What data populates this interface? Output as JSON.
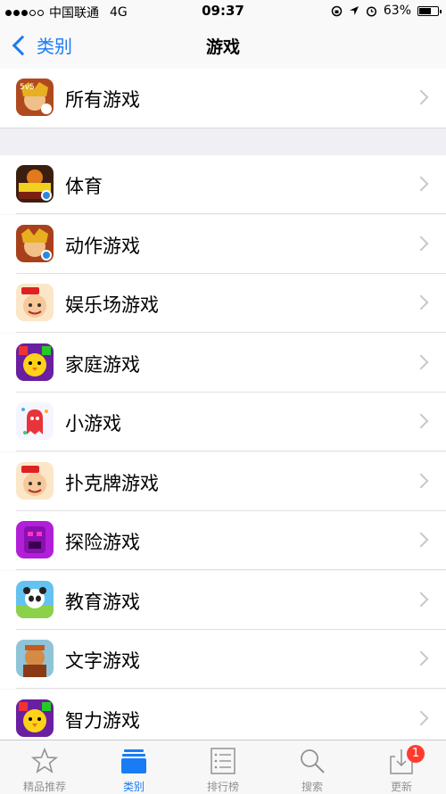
{
  "status_bar": {
    "carrier": "中国联通",
    "network": "4G",
    "time": "09:37",
    "battery": "63%",
    "battery_level": 0.63
  },
  "nav": {
    "back_label": "类别",
    "title": "游戏"
  },
  "all_games": {
    "label": "所有游戏",
    "icon": "king-glory-game-icon"
  },
  "categories": [
    {
      "label": "体育",
      "icon": "basketball-game-icon"
    },
    {
      "label": "动作游戏",
      "icon": "king-glory-game-icon"
    },
    {
      "label": "娱乐场游戏",
      "icon": "cartoon-boy-game-icon"
    },
    {
      "label": "家庭游戏",
      "icon": "chick-game-icon"
    },
    {
      "label": "小游戏",
      "icon": "red-ghost-game-icon"
    },
    {
      "label": "扑克牌游戏",
      "icon": "cartoon-boy-game-icon"
    },
    {
      "label": "探险游戏",
      "icon": "temple-run-game-icon"
    },
    {
      "label": "教育游戏",
      "icon": "panda-game-icon"
    },
    {
      "label": "文字游戏",
      "icon": "warrior-game-icon"
    },
    {
      "label": "智力游戏",
      "icon": "chick-game-icon"
    }
  ],
  "tabs": [
    {
      "label": "精品推荐",
      "icon": "star-icon"
    },
    {
      "label": "类别",
      "icon": "categories-icon",
      "active": true
    },
    {
      "label": "排行榜",
      "icon": "list-icon"
    },
    {
      "label": "搜索",
      "icon": "search-icon"
    },
    {
      "label": "更新",
      "icon": "download-icon",
      "badge": "1"
    }
  ],
  "colors": {
    "accent": "#1a7cf5",
    "badge": "#ff3b30"
  }
}
